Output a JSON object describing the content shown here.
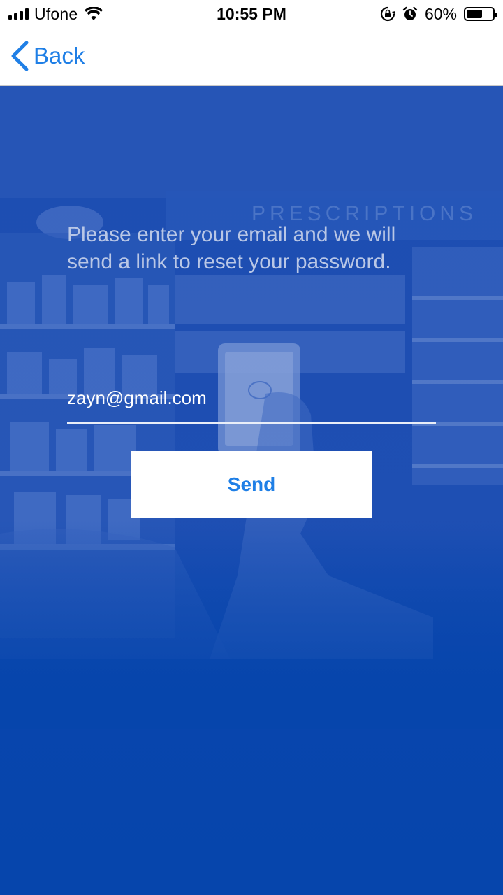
{
  "status_bar": {
    "carrier": "Ufone",
    "time": "10:55 PM",
    "battery_percent": "60%",
    "battery_level": 0.6
  },
  "nav": {
    "back_label": "Back"
  },
  "hero": {
    "background_sign": "PRESCRIPTIONS",
    "instructions": "Please enter your email and we will send a link to reset your password."
  },
  "form": {
    "email_value": "zayn@gmail.com",
    "send_label": "Send"
  },
  "colors": {
    "accent": "#1f7fe6",
    "background_blue": "#0645ac",
    "text_muted": "#b9c7e6"
  }
}
